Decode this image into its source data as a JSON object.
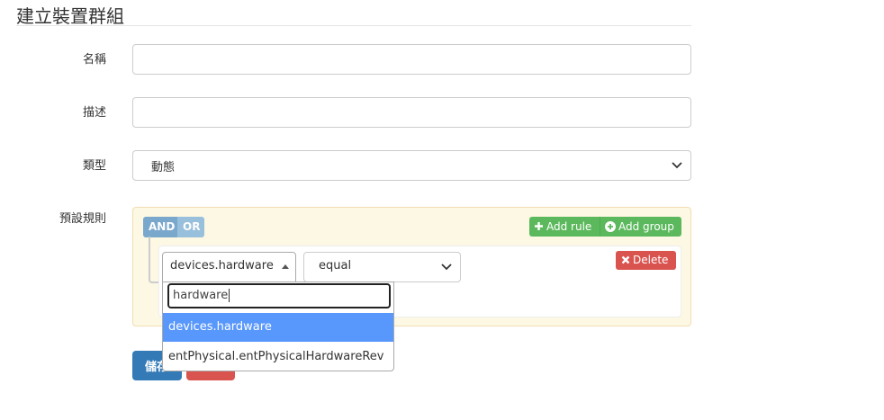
{
  "page": {
    "title": "建立裝置群組"
  },
  "form": {
    "name_label": "名稱",
    "name_value": "",
    "description_label": "描述",
    "description_value": "",
    "type_label": "類型",
    "type_selected": "動態",
    "rules_label": "預設規則"
  },
  "rule_builder": {
    "conditions": [
      "AND",
      "OR"
    ],
    "active_condition": "AND",
    "add_rule_label": "Add rule",
    "add_group_label": "Add group",
    "delete_label": "Delete",
    "rule": {
      "field_selected": "devices.hardware",
      "operator_selected": "equal"
    },
    "field_dropdown": {
      "search_value": "hardware",
      "options": [
        "devices.hardware",
        "entPhysical.entPhysicalHardwareRev"
      ],
      "highlighted_option": "devices.hardware"
    }
  },
  "actions": {
    "save_label": "儲存"
  },
  "colors": {
    "primary": "#337ab7",
    "success": "#5cb85c",
    "danger": "#d9534f",
    "condition_button": "#7aa7cc",
    "highlight": "#5897fb",
    "rules_panel_bg": "#fcf8e3"
  },
  "icons": {
    "add_rule": "plus-icon",
    "add_group": "plus-circle-icon",
    "delete": "close-icon",
    "select_arrow": "chevron-down-icon",
    "field_picker_arrow": "caret-up-icon"
  }
}
